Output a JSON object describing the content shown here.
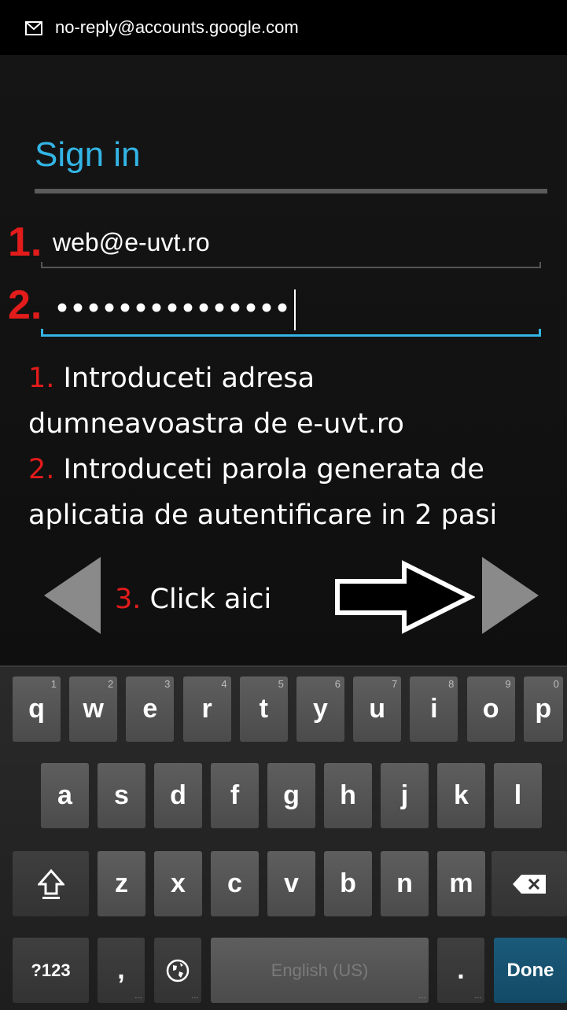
{
  "header": {
    "sender": "no-reply@accounts.google.com",
    "icon": "mail-icon"
  },
  "signin": {
    "title": "Sign in",
    "email_value": "web@e-uvt.ro",
    "password_mask": "•••••••••••••••",
    "accent_color": "#33b5e5"
  },
  "annotations": {
    "step1_num": "1.",
    "step2_num": "2.",
    "line1_num": "1.",
    "line1_text": " Introduceti adresa",
    "line2_text": "dumneavoastra de e-uvt.ro",
    "line3_num": "2.",
    "line3_text": " Introduceti parola generata de",
    "line4_text": "aplicatia de autentificare in 2 pasi",
    "step3_num": "3.",
    "step3_text": " Click aici",
    "red_color": "#e21b1b"
  },
  "navigation": {
    "prev_icon": "triangle-left-icon",
    "next_icon": "triangle-right-icon",
    "pointer_icon": "outline-arrow-right-icon"
  },
  "keyboard": {
    "row1": [
      {
        "k": "q",
        "h": "1"
      },
      {
        "k": "w",
        "h": "2"
      },
      {
        "k": "e",
        "h": "3"
      },
      {
        "k": "r",
        "h": "4"
      },
      {
        "k": "t",
        "h": "5"
      },
      {
        "k": "y",
        "h": "6"
      },
      {
        "k": "u",
        "h": "7"
      },
      {
        "k": "i",
        "h": "8"
      },
      {
        "k": "o",
        "h": "9"
      },
      {
        "k": "p",
        "h": "0"
      }
    ],
    "row2": [
      "a",
      "s",
      "d",
      "f",
      "g",
      "h",
      "j",
      "k",
      "l"
    ],
    "row3": [
      "z",
      "x",
      "c",
      "v",
      "b",
      "n",
      "m"
    ],
    "symbols": "?123",
    "comma": ",",
    "space": "English (US)",
    "period": ".",
    "done": "Done"
  }
}
